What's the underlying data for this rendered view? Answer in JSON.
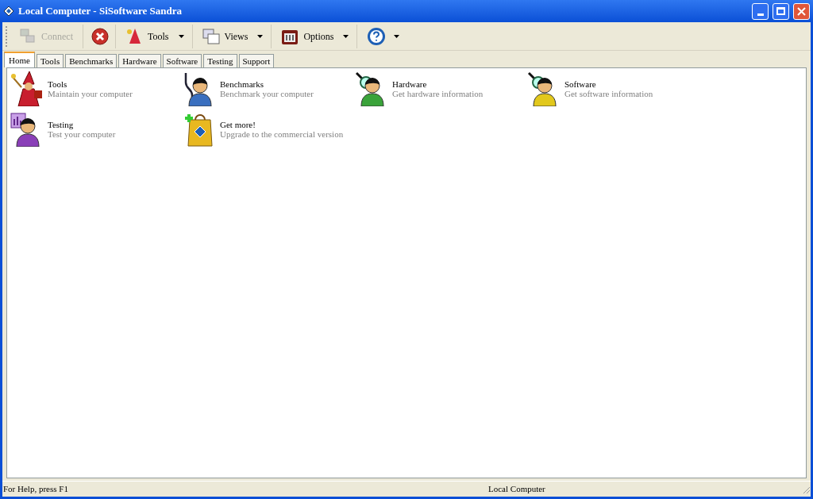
{
  "window": {
    "title": "Local Computer - SiSoftware Sandra"
  },
  "toolbar": [
    {
      "kind": "connect",
      "label": "Connect",
      "disabled": true
    },
    {
      "kind": "stop"
    },
    {
      "kind": "tools",
      "label": "Tools",
      "dropdown": true
    },
    {
      "kind": "views",
      "label": "Views",
      "dropdown": true
    },
    {
      "kind": "options",
      "label": "Options",
      "dropdown": true
    },
    {
      "kind": "help",
      "dropdown": true
    }
  ],
  "tabs": [
    {
      "label": "Home",
      "selected": true
    },
    {
      "label": "Tools",
      "selected": false
    },
    {
      "label": "Benchmarks",
      "selected": false
    },
    {
      "label": "Hardware",
      "selected": false
    },
    {
      "label": "Software",
      "selected": false
    },
    {
      "label": "Testing",
      "selected": false
    },
    {
      "label": "Support",
      "selected": false
    }
  ],
  "items": [
    {
      "title": "Tools",
      "description": "Maintain your computer"
    },
    {
      "title": "Benchmarks",
      "description": "Benchmark your computer"
    },
    {
      "title": "Hardware",
      "description": "Get hardware information"
    },
    {
      "title": "Software",
      "description": "Get software information"
    },
    {
      "title": "Testing",
      "description": "Test your computer"
    },
    {
      "title": "Get more!",
      "description": "Upgrade to the commercial version"
    }
  ],
  "status_bar": {
    "help": "For Help, press F1",
    "computer": "Local Computer"
  }
}
